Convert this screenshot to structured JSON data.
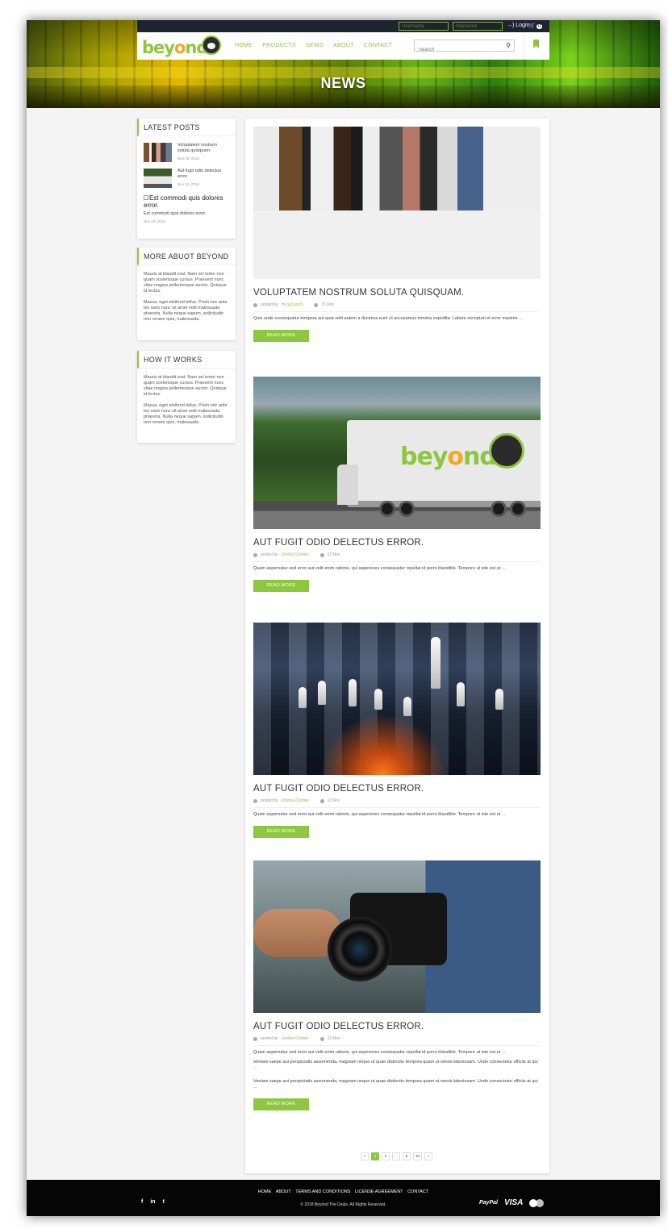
{
  "topbar": {
    "username_placeholder": "Username",
    "password_placeholder": "Password",
    "login_label": "→) Login",
    "cart_count": "0"
  },
  "nav": {
    "logo_text_a": "bey",
    "logo_text_b": "o",
    "logo_text_c": "nd",
    "links": [
      "HOME",
      "PRODUCTS",
      "NEWS",
      "ABOUT",
      "CONTACT"
    ],
    "search_placeholder": "Search"
  },
  "hero": {
    "title": "NEWS"
  },
  "sidebar": {
    "latest": {
      "heading": "LATEST POSTS",
      "posts": [
        {
          "title": "Voluptatem nostrum soluta quisquam.",
          "date": "Nov 15, 2018"
        },
        {
          "title": "Aut fugit odio delectus error.",
          "date": "Nov 13, 2018"
        }
      ],
      "broken": {
        "title": "Est commodi quis dolores error.",
        "text": "Est commodi quis dolores error.",
        "date": "Nov 13, 2018"
      }
    },
    "about": {
      "heading": "MORE ABUOT BEYOND",
      "p1": "Mauris at blandit erat. Nam vel tortor non quam scelerisque cursus. Praesent nunc vitae magna pellentesque auctor. Quisque id lectus.",
      "p2": "Massa, eget eleifend tellus. Proin nec ante leo ssim nunc sit amet velit malesuada pharetra. Nulla neque sapien, sollicitudin non ornare quis, malesuada."
    },
    "how": {
      "heading": "HOW IT WORKS",
      "p1": "Mauris at blandit erat. Nam vel tortor non quam scelerisque cursus. Praesent nunc vitae magna pellentesque auctor. Quisque id lectus.",
      "p2": "Massa, eget eleifend tellus. Proin nec ante leo ssim nunc sit amet velit malesuada pharetra. Nulla neque sapien, sollicitudin non ornare quis, malesuada."
    }
  },
  "articles": [
    {
      "title": "VOLUPTATEM NOSTRUM SOLUTA QUISQUAM.",
      "posted_by": "posted by",
      "author": "Hung Lynch",
      "date": "15 Nov",
      "excerpt": "Quis unde consequatur tempora aut quia velit autem a ducimus eum ut accusamus minima expedita. Labore excepturi et error maxime ...",
      "button": "READ MORE"
    },
    {
      "title": "AUT FUGIT ODIO DELECTUS ERROR.",
      "posted_by": "posted by",
      "author": "Joshua Dunbar",
      "date": "13 Nov",
      "excerpt": "Quam aspernatur sed error aut velit enim ratione, qui asperiores consequatur repellat id porro blanditiis. Tempore ut iste est ut ...",
      "button": "READ MORE"
    },
    {
      "title": "AUT FUGIT ODIO DELECTUS ERROR.",
      "posted_by": "posted by",
      "author": "Joshua Dunbar",
      "date": "13 Nov",
      "excerpt": "Quam aspernatur sed error aut velit enim ratione, qui asperiores consequatur repellat id porro blanditiis. Tempore ut iste est ut ...",
      "button": "READ MORE"
    },
    {
      "title": "AUT FUGIT ODIO DELECTUS ERROR.",
      "posted_by": "posted by",
      "author": "Joshua Dunbar",
      "date": "13 Nov",
      "excerpt": "Quam aspernatur sed error aut velit enim ratione, qui asperiores consequatur repellat id porro blanditiis. Tempore ut iste est ut ...",
      "extra1": "Veniam saepe aut perspiciatis assumenda, magnam neque ut quae distinctio tempora quam ut omnis laboriosam. Unde consectetur officiis at qui ...",
      "extra2": "Veniam saepe aut perspiciatis assumenda, magnam neque ut quae distinctio tempora quam ut omnis laboriosam. Unde consectetur officiis at qui ...",
      "button": "READ MORE"
    }
  ],
  "pagination": [
    "«",
    "1",
    "2",
    "...",
    "9",
    "10",
    "»"
  ],
  "footer": {
    "links": [
      "HOME",
      "ABOUT",
      "TERMS AND CONDITIONS",
      "LICENSE AGREEMENT",
      "CONTACT"
    ],
    "copyright": "© 2018 Beyond The Deals. All Rights Reserved.",
    "social": [
      "f",
      "in",
      "t"
    ],
    "payments": [
      "PayPal",
      "VISA"
    ]
  },
  "colors": {
    "accent": "#8dc63f",
    "topbar": "#1d2430",
    "footer": "#050505"
  }
}
